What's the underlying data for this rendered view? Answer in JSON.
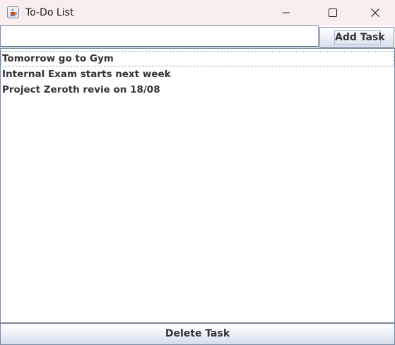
{
  "window": {
    "title": "To-Do List",
    "icon": "java-cup-icon",
    "controls": [
      "minimize-icon",
      "maximize-icon",
      "close-icon"
    ]
  },
  "input": {
    "value": "",
    "placeholder": ""
  },
  "toolbar": {
    "add_label": "Add Task"
  },
  "tasks": [
    "Tomorrow go to Gym",
    "Internal Exam starts next week",
    "Project Zeroth revie on 18/08"
  ],
  "footer": {
    "delete_label": "Delete Task"
  },
  "colors": {
    "titlebar": "#f9eded",
    "border": "#7a8aa0",
    "text": "#333333"
  }
}
